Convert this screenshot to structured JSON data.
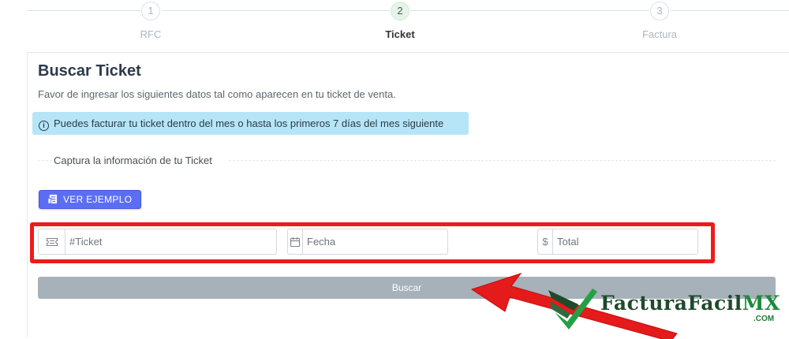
{
  "stepper": {
    "steps": [
      {
        "number": "1",
        "label": "RFC",
        "active": false
      },
      {
        "number": "2",
        "label": "Ticket",
        "active": true
      },
      {
        "number": "3",
        "label": "Factura",
        "active": false
      }
    ]
  },
  "card": {
    "title": "Buscar Ticket",
    "subtitle": "Favor de ingresar los siguientes datos tal como aparecen en tu ticket de venta.",
    "alert": "Puedes facturar tu ticket dentro del mes o hasta los primeros 7 días del mes siguiente",
    "divider": "Captura la información de tu Ticket",
    "example_button": "VER EJEMPLO",
    "fields": {
      "ticket": {
        "placeholder": "#Ticket",
        "value": "",
        "icon": "ticket-icon"
      },
      "fecha": {
        "placeholder": "Fecha",
        "value": "",
        "icon": "calendar-icon"
      },
      "total": {
        "placeholder": "Total",
        "value": "",
        "icon": "dollar-icon",
        "addon_symbol": "$"
      }
    },
    "search_button": "Buscar"
  },
  "colors": {
    "accent": "#5b6ef3",
    "highlight": "#ee1b1b",
    "alert_bg": "#b6e5f7",
    "disabled_button": "#a7b1b9"
  },
  "logo": {
    "name": "FacturaFacil",
    "suffix": "MX",
    "domain": ".COM"
  }
}
